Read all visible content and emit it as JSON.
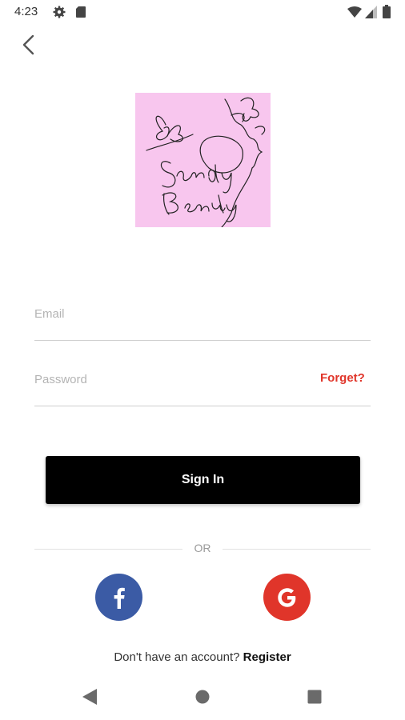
{
  "status_bar": {
    "time": "4:23",
    "icons": [
      "gear-icon",
      "sd-card-icon",
      "wifi-icon",
      "signal-icon",
      "battery-icon"
    ]
  },
  "header": {
    "back_icon": "chevron-left-icon"
  },
  "logo": {
    "text_line1": "Sandy",
    "text_line2": "Beauty",
    "background": "#f8c6ee"
  },
  "form": {
    "email_placeholder": "Email",
    "email_value": "",
    "password_placeholder": "Password",
    "password_value": "",
    "forget_label": "Forget?",
    "sign_in_label": "Sign In"
  },
  "divider": {
    "label": "OR"
  },
  "social": {
    "facebook_icon": "facebook-icon",
    "google_icon": "google-icon",
    "facebook_color": "#3b5ba5",
    "google_color": "#e0352a"
  },
  "register": {
    "prompt": "Don't have an account?",
    "link_label": "Register"
  },
  "colors": {
    "accent_red": "#e0352a",
    "button_black": "#000000"
  },
  "nav_bar": {
    "icons": [
      "nav-back-icon",
      "nav-home-icon",
      "nav-recents-icon"
    ]
  }
}
